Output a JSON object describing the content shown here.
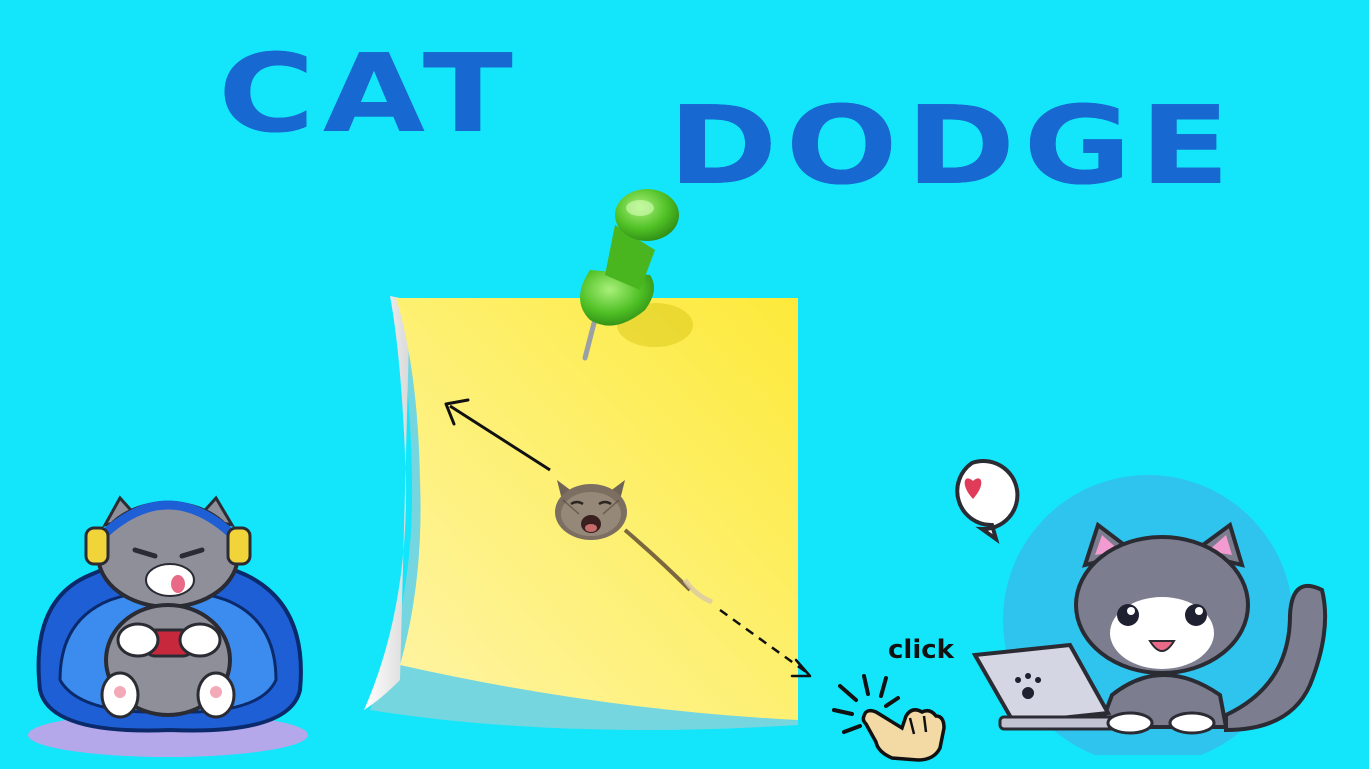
{
  "game": {
    "title_word_1": "CAT",
    "title_word_2": "DODGE",
    "click_hint": "click"
  },
  "icons": {
    "pin": "push-pin-icon",
    "hand": "pointing-hand-icon",
    "heart": "heart-speech-bubble-icon"
  },
  "colors": {
    "background": "#13e6fb",
    "title": "#1768d0",
    "note": "#fdeb4b",
    "pin": "#56c52a"
  }
}
